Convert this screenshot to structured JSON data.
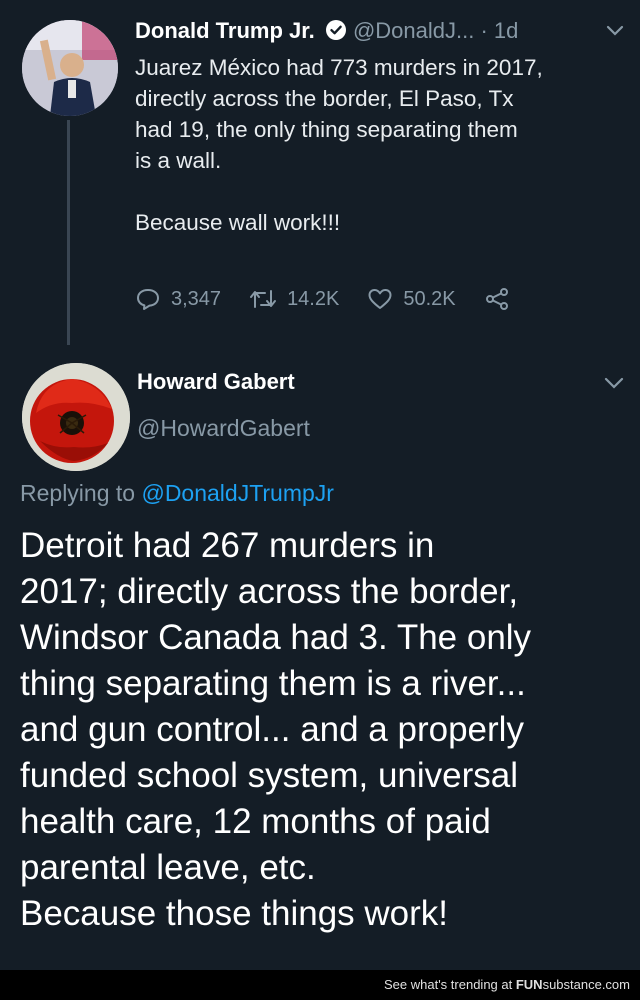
{
  "tweet1": {
    "name": "Donald Trump Jr.",
    "handle": "@DonaldJ...",
    "dot": "·",
    "time": "1d",
    "lines": [
      "Juarez México had 773 murders in 2017,",
      "directly across the border, El Paso, Tx",
      "had 19, the only thing separating them",
      "is a wall."
    ],
    "line2": "Because wall work!!!",
    "replies": "3,347",
    "retweets": "14.2K",
    "likes": "50.2K",
    "icons": [
      "verified-icon",
      "chevron-down-icon",
      "reply-icon",
      "retweet-icon",
      "like-icon",
      "share-icon"
    ]
  },
  "tweet2": {
    "name": "Howard Gabert",
    "handle": "@HowardGabert",
    "replying_prefix": "Replying to ",
    "replying_handle": "@DonaldJTrumpJr",
    "lines": [
      "Detroit had 267 murders in",
      "2017; directly across the border,",
      "Windsor Canada had 3.  The only",
      "thing separating them is a river...",
      "and gun control... and a properly",
      "funded school system, universal",
      "health care, 12 months of paid",
      "parental leave, etc.",
      "Because those things work!"
    ]
  },
  "footer": {
    "prefix": "See what's trending at ",
    "brand_bold": "FUN",
    "brand_rest": "substance.com"
  },
  "colors": {
    "background": "#141d26",
    "muted": "#8899a6",
    "link": "#1da1f2",
    "verified": "#ffffff"
  }
}
